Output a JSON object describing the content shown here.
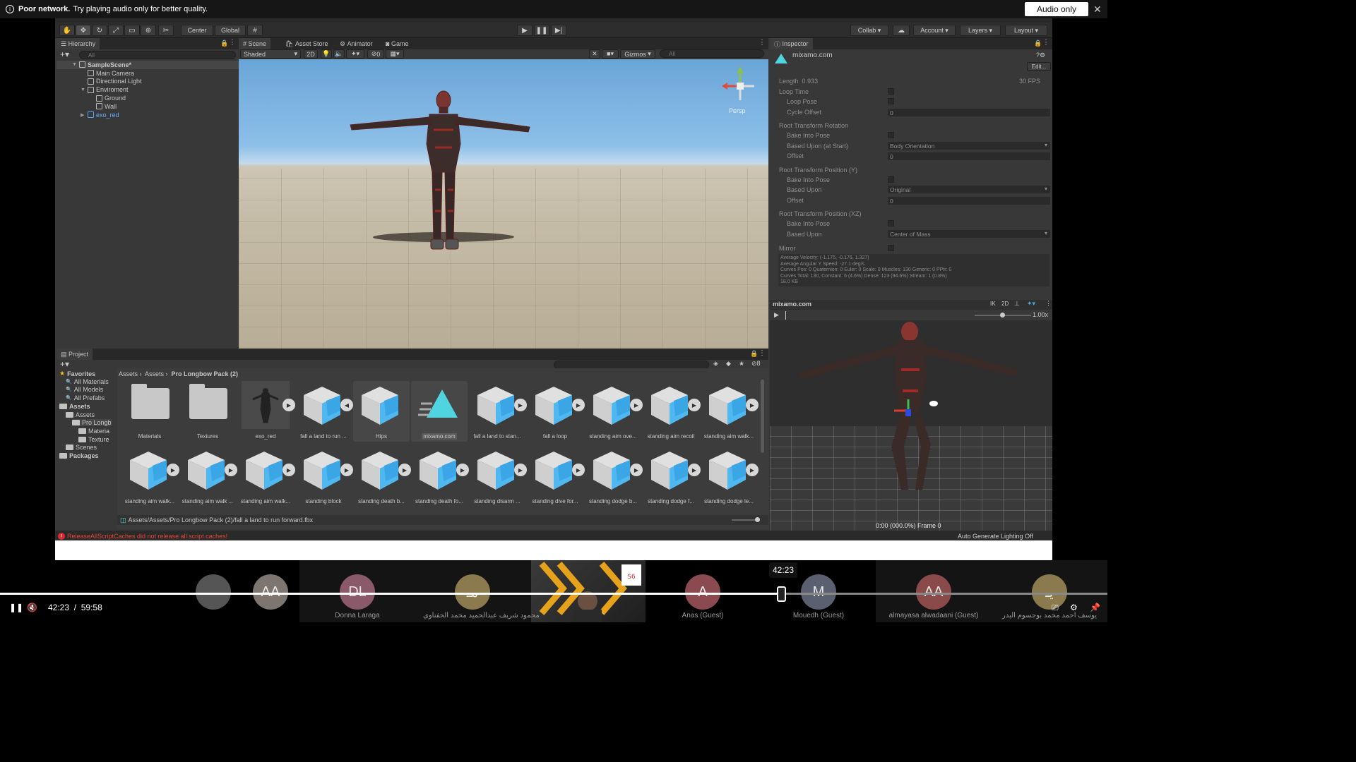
{
  "notification": {
    "bold": "Poor network.",
    "text": "Try playing audio only for better quality.",
    "button": "Audio only"
  },
  "toolbar": {
    "center": "Center",
    "global": "Global",
    "collab": "Collab",
    "account": "Account",
    "layers": "Layers",
    "layout": "Layout"
  },
  "hierarchy": {
    "title": "Hierarchy",
    "search_placeholder": "All",
    "items": [
      {
        "label": "SampleScene*",
        "indent": 0
      },
      {
        "label": "Main Camera",
        "indent": 1
      },
      {
        "label": "Directional Light",
        "indent": 1
      },
      {
        "label": "Enviroment",
        "indent": 1
      },
      {
        "label": "Ground",
        "indent": 2
      },
      {
        "label": "Wall",
        "indent": 2
      },
      {
        "label": "exo_red",
        "indent": 1
      }
    ]
  },
  "scene": {
    "tabs": [
      "Scene",
      "Asset Store",
      "Animator",
      "Game"
    ],
    "shading": "Shaded",
    "mode2d": "2D",
    "hidden_count": "0",
    "gizmos": "Gizmos",
    "search_placeholder": "All",
    "persp": "Persp"
  },
  "inspector": {
    "title": "Inspector",
    "asset_name": "mixamo.com",
    "edit": "Edit...",
    "length_label": "Length",
    "length_value": "0.933",
    "fps": "30 FPS",
    "rows": {
      "loop_time": "Loop Time",
      "loop_pose": "Loop Pose",
      "cycle_offset": "Cycle Offset",
      "rtr": "Root Transform Rotation",
      "bake1": "Bake Into Pose",
      "based_start": "Based Upon (at Start)",
      "offset1": "Offset",
      "rtpy": "Root Transform Position (Y)",
      "bake2": "Bake Into Pose",
      "based2": "Based Upon",
      "offset2": "Offset",
      "rtpxz": "Root Transform Position (XZ)",
      "bake3": "Bake Into Pose",
      "based3": "Based Upon",
      "mirror": "Mirror"
    },
    "values": {
      "cycle_offset": "0",
      "based_start": "Body Orientation",
      "offset1": "0",
      "based2": "Original",
      "offset2": "0",
      "based3": "Center of Mass"
    },
    "stats": [
      "Average Velocity: (-1.175, -0.176, 1.327)",
      "Average Angular Y Speed: -27.1 deg/s",
      "Curves Pos: 0 Quaternion: 0 Euler: 0 Scale: 0 Muscles: 130 Generic: 0 PPtr: 0",
      "Curves Total: 130, Constant: 6 (4.6%) Dense: 123 (94.6%) Stream: 1 (0.8%)",
      "18.0 KB"
    ],
    "preview": {
      "title": "mixamo.com",
      "ik": "IK",
      "mode2d": "2D",
      "speed": "1.00x",
      "frame": "0:00 (000.0%) Frame 0"
    }
  },
  "project": {
    "title": "Project",
    "breadcrumb": [
      "Assets",
      "Assets",
      "Pro Longbow Pack (2)"
    ],
    "hidden_count": "8",
    "tree": [
      {
        "label": "Favorites",
        "indent": 0,
        "type": "star"
      },
      {
        "label": "All Materials",
        "indent": 1,
        "type": "search"
      },
      {
        "label": "All Models",
        "indent": 1,
        "type": "search"
      },
      {
        "label": "All Prefabs",
        "indent": 1,
        "type": "search"
      },
      {
        "label": "Assets",
        "indent": 0,
        "type": "folder"
      },
      {
        "label": "Assets",
        "indent": 1,
        "type": "folder"
      },
      {
        "label": "Pro Longb",
        "indent": 2,
        "type": "folder"
      },
      {
        "label": "Materia",
        "indent": 3,
        "type": "folder"
      },
      {
        "label": "Texture",
        "indent": 3,
        "type": "folder"
      },
      {
        "label": "Scenes",
        "indent": 1,
        "type": "folder"
      },
      {
        "label": "Packages",
        "indent": 0,
        "type": "folder"
      }
    ],
    "assets_row1": [
      {
        "label": "Materials",
        "kind": "folder"
      },
      {
        "label": "Textures",
        "kind": "folder"
      },
      {
        "label": "exo_red",
        "kind": "model"
      },
      {
        "label": "fall a land to run ...",
        "kind": "prefab"
      },
      {
        "label": "Hips",
        "kind": "prefab"
      },
      {
        "label": "mixamo.com",
        "kind": "clip"
      },
      {
        "label": "fall a land to stan...",
        "kind": "prefab"
      },
      {
        "label": "fall a loop",
        "kind": "prefab"
      },
      {
        "label": "standing aim ove...",
        "kind": "prefab"
      },
      {
        "label": "standing aim recoil",
        "kind": "prefab"
      },
      {
        "label": "standing aim walk...",
        "kind": "prefab"
      }
    ],
    "assets_row2": [
      {
        "label": "standing aim walk...",
        "kind": "prefab"
      },
      {
        "label": "standing aim walk ...",
        "kind": "prefab"
      },
      {
        "label": "standing aim walk...",
        "kind": "prefab"
      },
      {
        "label": "standing block",
        "kind": "prefab"
      },
      {
        "label": "standing death b...",
        "kind": "prefab"
      },
      {
        "label": "standing death fo...",
        "kind": "prefab"
      },
      {
        "label": "standing disarm ...",
        "kind": "prefab"
      },
      {
        "label": "standing dive for...",
        "kind": "prefab"
      },
      {
        "label": "standing dodge b...",
        "kind": "prefab"
      },
      {
        "label": "standing dodge f...",
        "kind": "prefab"
      },
      {
        "label": "standing dodge le...",
        "kind": "prefab"
      }
    ],
    "path": "Assets/Assets/Pro Longbow Pack (2)/fall a land to run forward.fbx"
  },
  "status": {
    "error": "ReleaseAllScriptCaches did not release all script caches!",
    "lighting": "Auto Generate Lighting Off"
  },
  "participants": [
    {
      "initials": "",
      "name": "",
      "color": "#555"
    },
    {
      "initials": "AA",
      "name": "",
      "color": "#7d7670"
    },
    {
      "initials": "DL",
      "name": "Donna Laraga",
      "color": "#8a5a6a"
    },
    {
      "initials": "مـ",
      "name": "محمود شريف عبدالحميد محمد الحفناوي",
      "color": "#8a7a4e"
    },
    {
      "initials": "A",
      "name": "Anas (Guest)",
      "color": "#8a4a50"
    },
    {
      "initials": "M",
      "name": "Mouedh (Guest)",
      "color": "#5a6070"
    },
    {
      "initials": "AA",
      "name": "almayasa alwadaani (Guest)",
      "color": "#8a4a4a"
    },
    {
      "initials": "يـ",
      "name": "يوسف احمد محمد بوجسوم البدر",
      "color": "#8a7a4e"
    }
  ],
  "player": {
    "current": "42:23",
    "total": "59:58",
    "separator": "/",
    "tooltip": "42:23",
    "progress": 0.7068
  }
}
